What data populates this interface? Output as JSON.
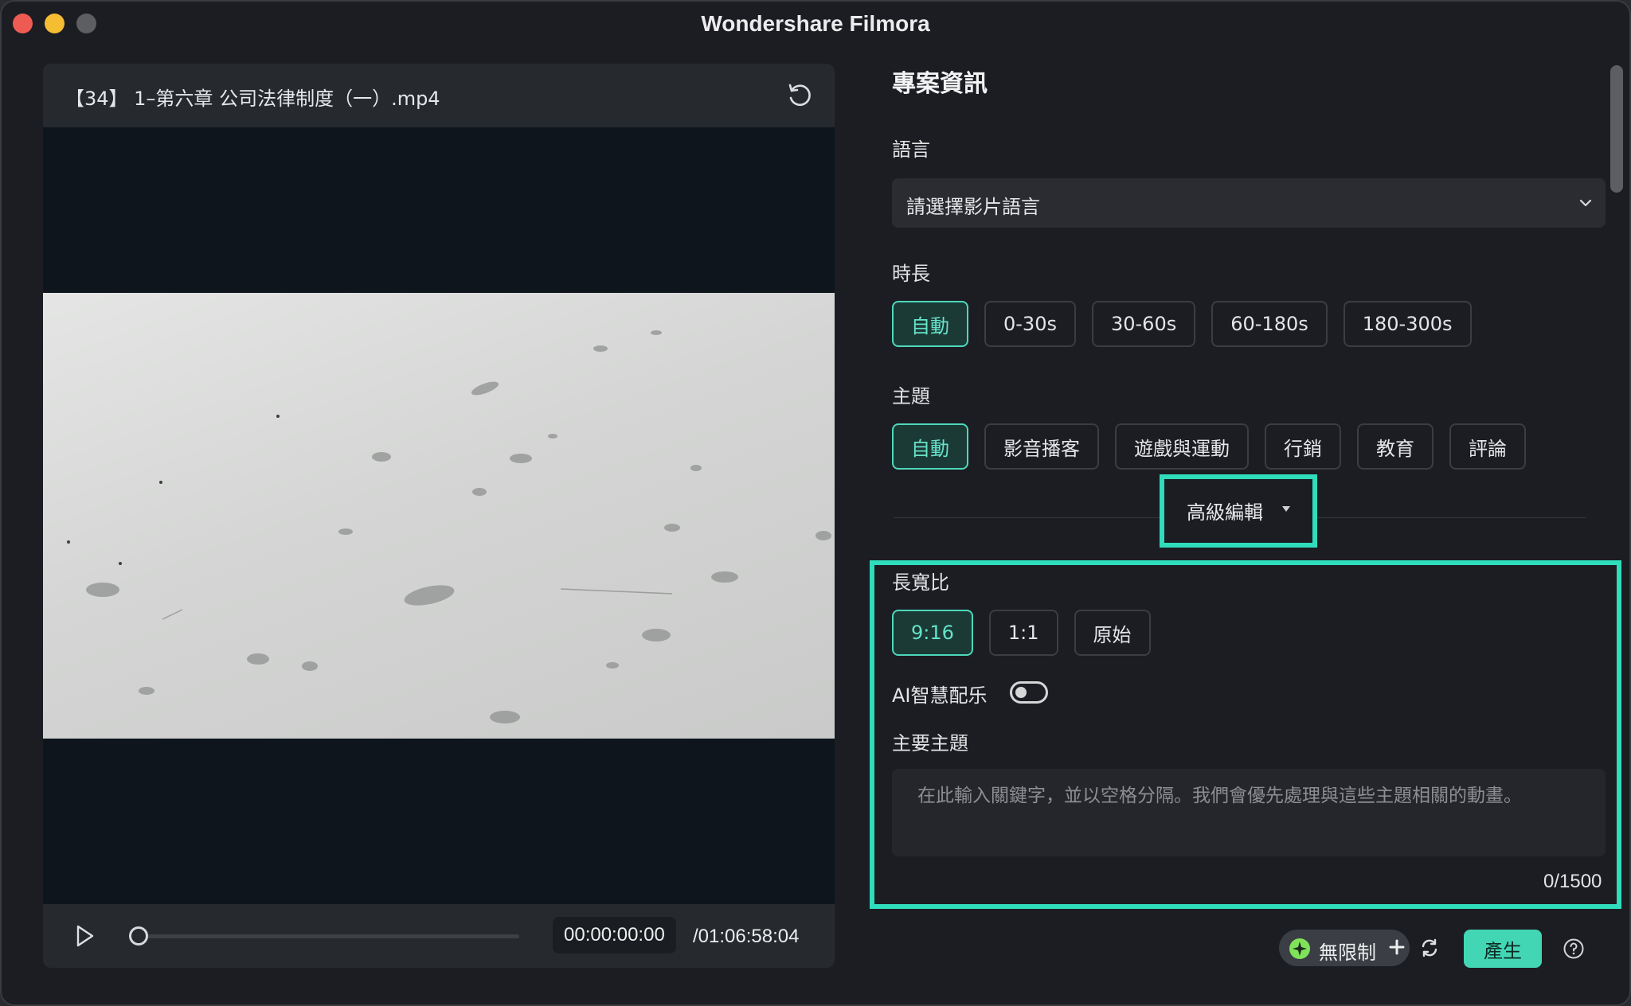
{
  "window": {
    "title": "Wondershare Filmora"
  },
  "preview": {
    "file_name": "【34】 1–第六章 公司法律制度（一）.mp4",
    "current_time": "00:00:00:00",
    "total_time": "/01:06:58:04",
    "progress": 0
  },
  "project": {
    "heading": "專案資訊",
    "language": {
      "label": "語言",
      "placeholder": "請選擇影片語言"
    },
    "duration": {
      "label": "時長",
      "options": [
        "自動",
        "0-30s",
        "30-60s",
        "60-180s",
        "180-300s"
      ],
      "selected": "自動"
    },
    "theme": {
      "label": "主題",
      "options": [
        "自動",
        "影音播客",
        "遊戲與運動",
        "行銷",
        "教育",
        "評論"
      ],
      "selected": "自動"
    },
    "advanced_label": "高級編輯",
    "aspect_ratio": {
      "label": "長寬比",
      "options": [
        "9:16",
        "1:1",
        "原始"
      ],
      "selected": "9:16"
    },
    "ai_music": {
      "label": "AI智慧配乐",
      "enabled": false
    },
    "main_topic": {
      "label": "主要主題",
      "placeholder": "在此輸入關鍵字，並以空格分隔。我們會優先處理與這些主題相關的動畫。",
      "count": "0/1500"
    }
  },
  "footer": {
    "credits_label": "無限制",
    "generate_label": "產生"
  },
  "colors": {
    "accent": "#43d6b5",
    "highlight": "#2fdcbb"
  }
}
